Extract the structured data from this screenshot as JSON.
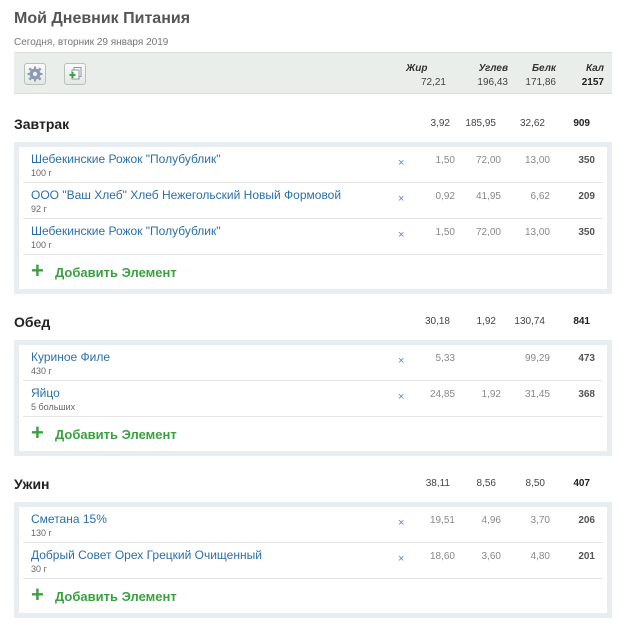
{
  "page": {
    "title": "Мой Дневник Питания",
    "subtitle": "Сегодня, вторник 29 января 2019"
  },
  "header": {
    "labels": {
      "fat": "Жир",
      "carb": "Углев",
      "protein": "Белк",
      "cal": "Кал"
    },
    "totals": {
      "fat": "72,21",
      "carb": "196,43",
      "protein": "171,86",
      "cal": "2157"
    }
  },
  "colors": {
    "link": "#2a6fa8",
    "add": "#3aa141",
    "box_border": "#e8edf2"
  },
  "icons": {
    "settings": "gear-icon",
    "add_copy": "add-copy-icon",
    "remove": "remove-x-icon",
    "add": "plus-icon"
  },
  "meals": [
    {
      "title": "Завтрак",
      "totals": {
        "fat": "3,92",
        "carb": "185,95",
        "protein": "32,62",
        "cal": "909"
      },
      "items": [
        {
          "name": "Шебекинские Рожок \"Полубублик\"",
          "qty": "100 г",
          "remove": "×",
          "fat": "1,50",
          "carb": "72,00",
          "protein": "13,00",
          "cal": "350"
        },
        {
          "name": "ООО \"Ваш Хлеб\" Хлеб Нежегольский Новый Формовой",
          "qty": "92 г",
          "remove": "×",
          "fat": "0,92",
          "carb": "41,95",
          "protein": "6,62",
          "cal": "209"
        },
        {
          "name": "Шебекинские Рожок \"Полубублик\"",
          "qty": "100 г",
          "remove": "×",
          "fat": "1,50",
          "carb": "72,00",
          "protein": "13,00",
          "cal": "350"
        }
      ],
      "add_label": "Добавить Элемент",
      "add_icon": "+"
    },
    {
      "title": "Обед",
      "totals": {
        "fat": "30,18",
        "carb": "1,92",
        "protein": "130,74",
        "cal": "841"
      },
      "items": [
        {
          "name": "Куриное Филе",
          "qty": "430 г",
          "remove": "×",
          "fat": "5,33",
          "carb": "",
          "protein": "99,29",
          "cal": "473"
        },
        {
          "name": "Яйцо",
          "qty": "5 больших",
          "remove": "×",
          "fat": "24,85",
          "carb": "1,92",
          "protein": "31,45",
          "cal": "368"
        }
      ],
      "add_label": "Добавить Элемент",
      "add_icon": "+"
    },
    {
      "title": "Ужин",
      "totals": {
        "fat": "38,11",
        "carb": "8,56",
        "protein": "8,50",
        "cal": "407"
      },
      "items": [
        {
          "name": "Сметана 15%",
          "qty": "130 г",
          "remove": "×",
          "fat": "19,51",
          "carb": "4,96",
          "protein": "3,70",
          "cal": "206"
        },
        {
          "name": "Добрый Совет Орех Грецкий Очищенный",
          "qty": "30 г",
          "remove": "×",
          "fat": "18,60",
          "carb": "3,60",
          "protein": "4,80",
          "cal": "201"
        }
      ],
      "add_label": "Добавить Элемент",
      "add_icon": "+"
    }
  ]
}
